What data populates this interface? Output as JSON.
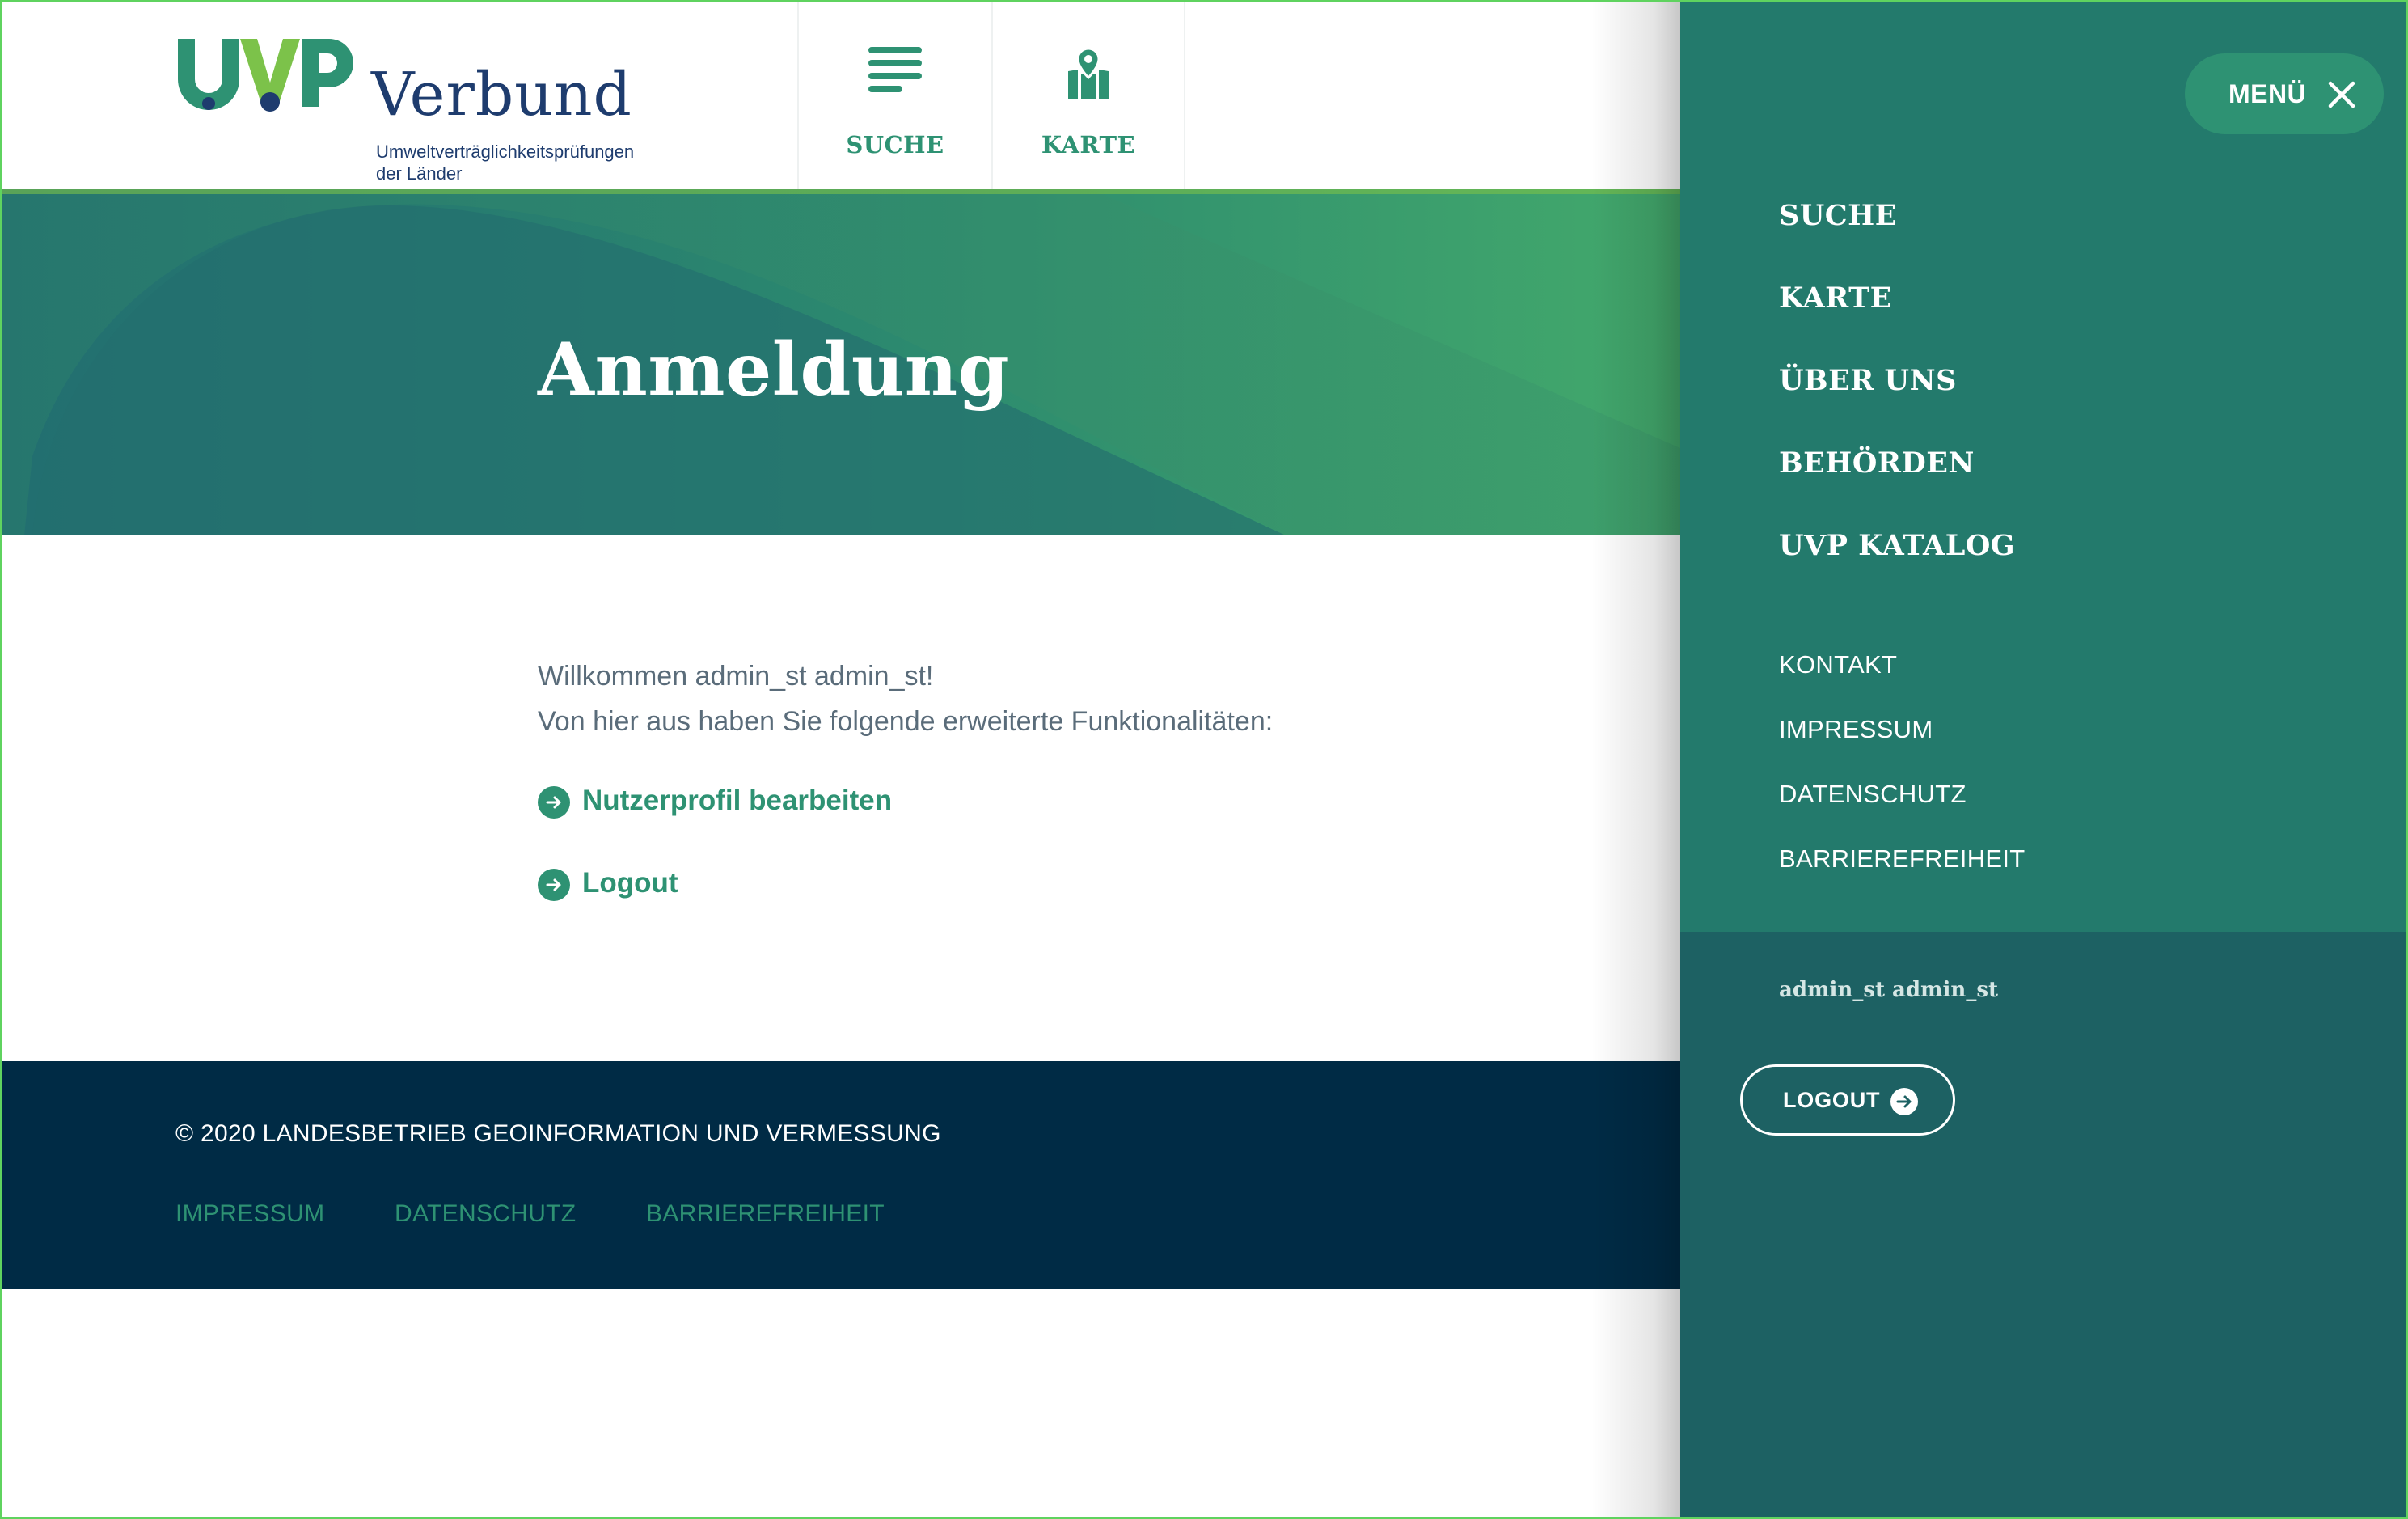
{
  "header": {
    "logo_letters": "UVP",
    "logo_word": "Verbund",
    "logo_subtitle_line1": "Umweltverträglichkeitsprüfungen",
    "logo_subtitle_line2": "der Länder",
    "nav": [
      {
        "label": "SUCHE",
        "icon": "search-list-icon"
      },
      {
        "label": "KARTE",
        "icon": "map-pin-icon"
      }
    ]
  },
  "hero": {
    "title": "Anmeldung"
  },
  "main": {
    "welcome_line1": "Willkommen admin_st admin_st!",
    "welcome_line2": "Von hier aus haben Sie folgende erweiterte Funktionalitäten:",
    "actions": [
      {
        "label": "Nutzerprofil bearbeiten",
        "icon": "arrow-right-circle-icon"
      },
      {
        "label": "Logout",
        "icon": "arrow-right-circle-icon"
      }
    ]
  },
  "footer": {
    "copyright": "© 2020 LANDESBETRIEB GEOINFORMATION UND VERMESSUNG",
    "links": [
      "IMPRESSUM",
      "DATENSCHUTZ",
      "BARRIEREFREIHEIT"
    ]
  },
  "sidemenu": {
    "menu_button_label": "MENÜ",
    "primary_items": [
      "SUCHE",
      "KARTE",
      "ÜBER UNS",
      "BEHÖRDEN",
      "UVP KATALOG"
    ],
    "secondary_items": [
      "KONTAKT",
      "IMPRESSUM",
      "DATENSCHUTZ",
      "BARRIEREFREIHEIT"
    ],
    "user_name": "admin_st admin_st",
    "logout_label": "LOGOUT"
  },
  "colors": {
    "brand_green": "#2e9273",
    "brand_navy": "#1e3c6e",
    "menu_bg": "#237a6c",
    "menu_lower_bg": "#1d6163",
    "footer_bg": "#002b45",
    "text_gray": "#5a6c7a"
  }
}
